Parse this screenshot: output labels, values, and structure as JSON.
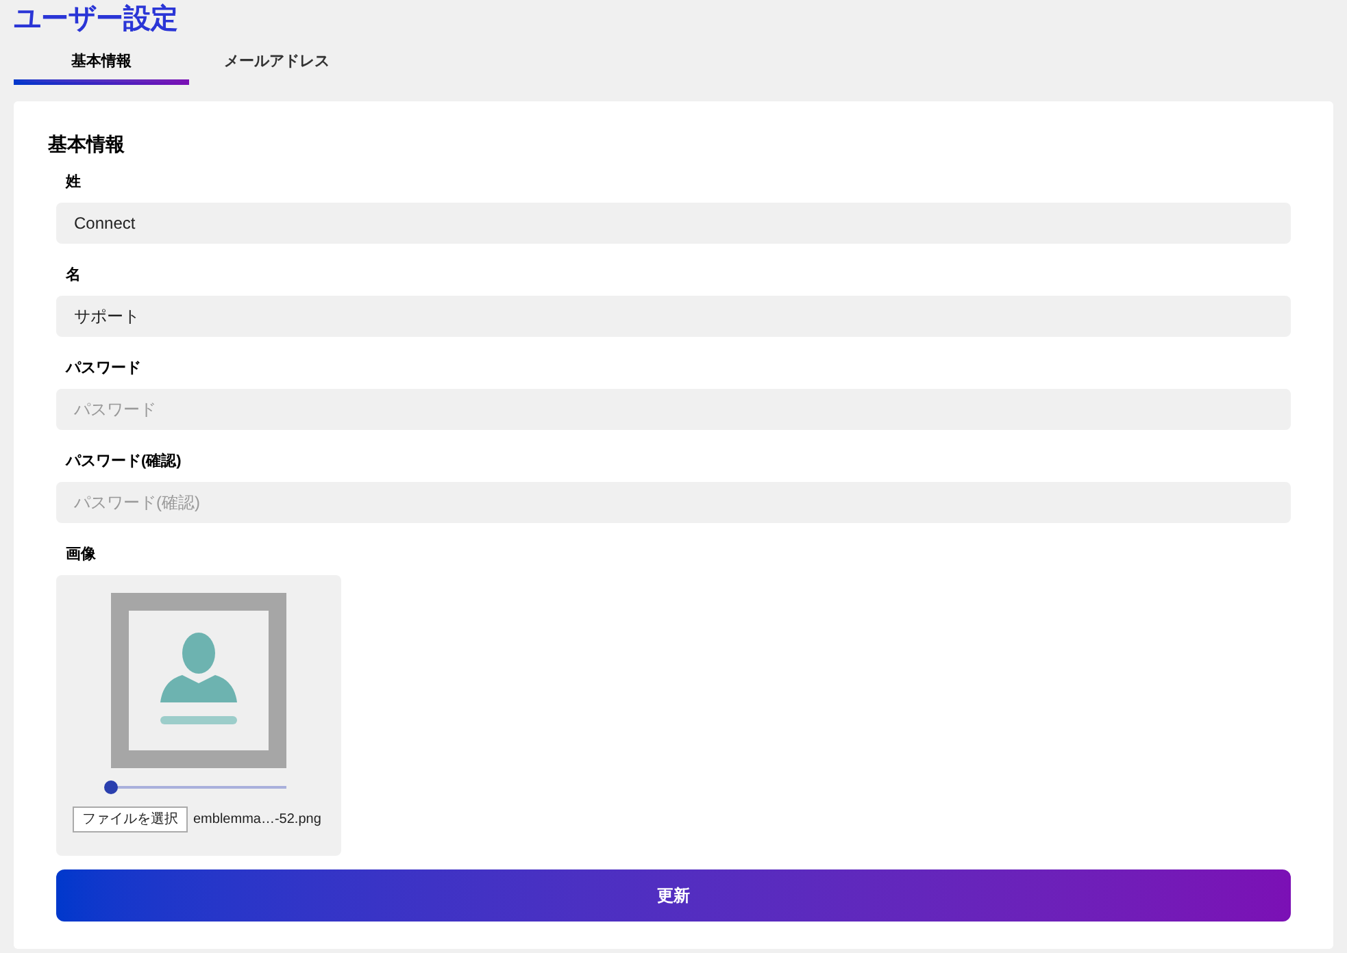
{
  "title": "ユーザー設定",
  "tabs": [
    {
      "label": "基本情報",
      "selected": true
    },
    {
      "label": "メールアドレス",
      "selected": false
    }
  ],
  "section_title": "基本情報",
  "fields": [
    {
      "label": "姓",
      "value": "Connect"
    },
    {
      "label": "名",
      "value": "サポート"
    },
    {
      "label": "パスワード",
      "placeholder": "パスワード"
    },
    {
      "label": "パスワード(確認)",
      "placeholder": "パスワード(確認)"
    }
  ],
  "image": {
    "label": "画像",
    "zoom": {
      "level": 0
    },
    "file_button": "ファイルを選択",
    "file_name": "emblemma…-52.png"
  },
  "submit_button": "更新"
}
